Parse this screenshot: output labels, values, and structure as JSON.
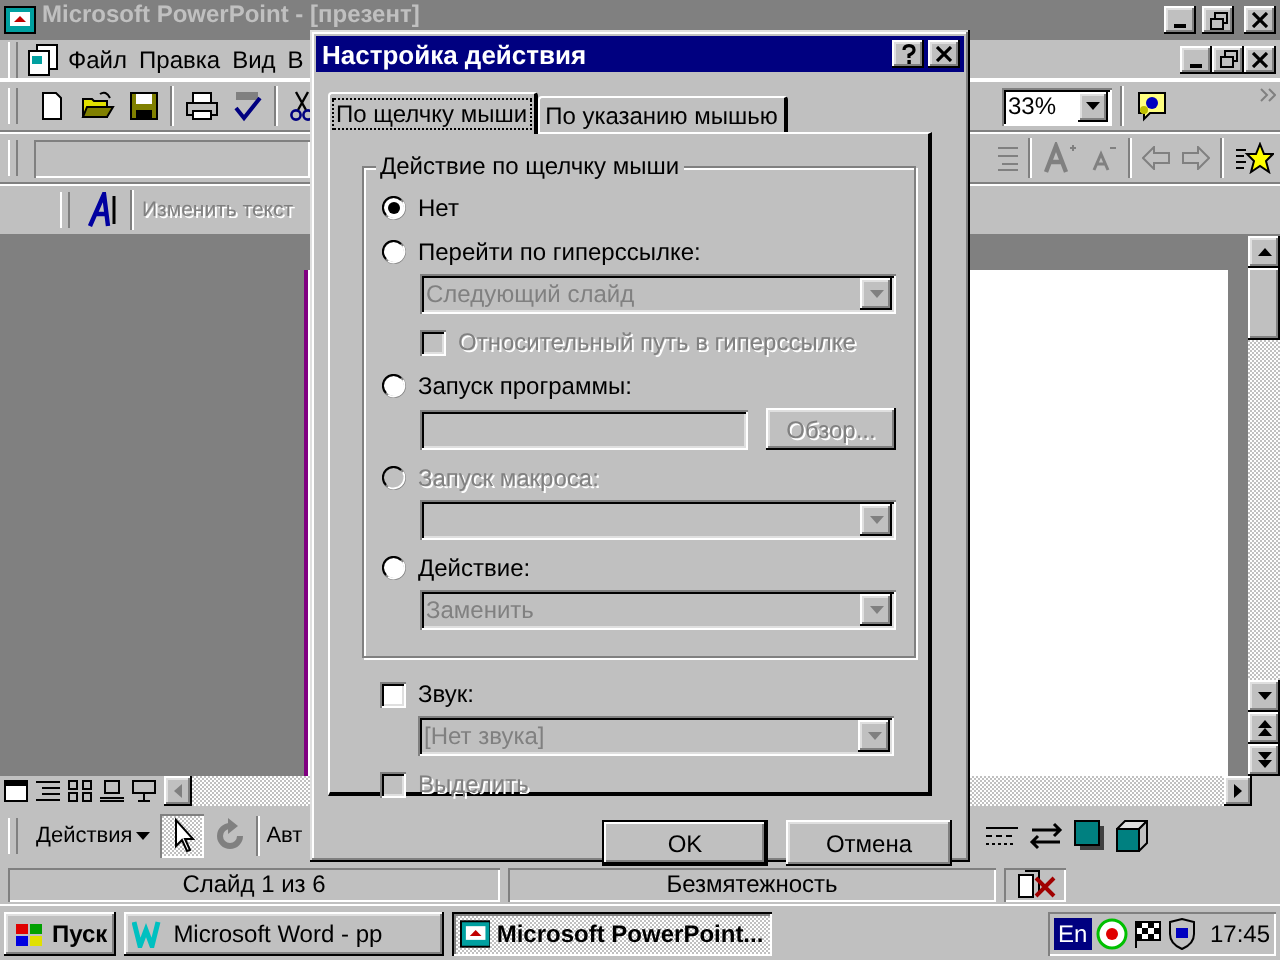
{
  "app": {
    "title": "Microsoft PowerPoint - [презент]",
    "menu": [
      {
        "label": "Файл"
      },
      {
        "label": "Правка"
      },
      {
        "label": "Вид"
      },
      {
        "label": "В"
      }
    ],
    "zoom": "33%",
    "wordart_button": "Изменить текст",
    "actions_menu": "Действия",
    "autoshapes": "Авт",
    "status": [
      "Слайд 1 из 6",
      "Безмятежность"
    ]
  },
  "dialog": {
    "title": "Настройка действия",
    "tabs": [
      {
        "label": "По щелчку мыши",
        "selected": true
      },
      {
        "label": "По указанию мышью",
        "selected": false
      }
    ],
    "group": {
      "title": "Действие по щелчку мыши",
      "rows": [
        {
          "kind": "radio",
          "label": "Нет",
          "selected": true,
          "disabled": false
        },
        {
          "kind": "radio",
          "label": "Перейти по гиперссылке:",
          "selected": false,
          "disabled": false
        },
        {
          "kind": "select",
          "value": "Следующий слайд",
          "disabled": true
        },
        {
          "kind": "checkbox",
          "label": "Относительный путь в гиперссылке",
          "checked": false,
          "disabled": true
        },
        {
          "kind": "radio",
          "label": "Запуск программы:",
          "selected": false,
          "disabled": false
        },
        {
          "kind": "browse",
          "button": "Обзор...",
          "disabled": true
        },
        {
          "kind": "radio",
          "label": "Запуск макроса:",
          "selected": false,
          "disabled": true
        },
        {
          "kind": "select",
          "disabled": true
        },
        {
          "kind": "radio",
          "label": "Действие:",
          "selected": false,
          "disabled": false
        },
        {
          "kind": "select",
          "value": "Заменить",
          "disabled": true
        }
      ]
    },
    "rows": [
      {
        "kind": "checkbox",
        "label": "Звук:",
        "checked": false,
        "disabled": false
      },
      {
        "kind": "select",
        "value": "[Нет звука]",
        "disabled": true
      },
      {
        "kind": "checkbox",
        "label": "Выделить",
        "checked": false,
        "disabled": true
      }
    ],
    "buttons": [
      {
        "label": "OK",
        "default": true
      },
      {
        "label": "Отмена",
        "default": false
      }
    ]
  },
  "taskbar": {
    "start": "Пуск",
    "tasks": [
      {
        "label": "Microsoft Word - pp",
        "selected": false
      },
      {
        "label": "Microsoft PowerPoint...",
        "selected": true
      }
    ],
    "language": "En",
    "clock": "17:45"
  }
}
